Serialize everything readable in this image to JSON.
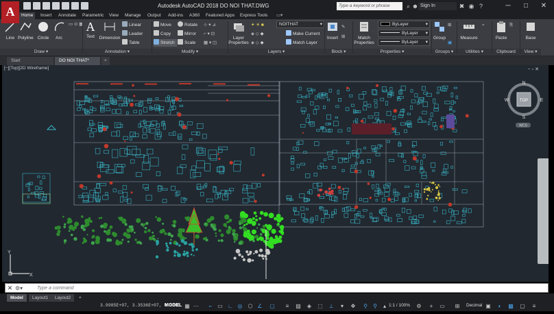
{
  "title_bar": {
    "logo_letter": "A",
    "window_title": "Autodesk AutoCAD 2018    DO NOI THAT.DWG",
    "search_placeholder": "Type a keyword or phrase",
    "signin_label": "Sign In"
  },
  "ribbon_tabs": [
    "Home",
    "Insert",
    "Annotate",
    "Parametric",
    "View",
    "Manage",
    "Output",
    "Add-ins",
    "A360",
    "Featured Apps",
    "Express Tools"
  ],
  "ribbon": {
    "draw": {
      "title": "Draw",
      "line": "Line",
      "polyline": "Polyline",
      "circle": "Circle",
      "arc": "Arc"
    },
    "annotation": {
      "title": "Annotation",
      "text": "Text",
      "dimension": "Dimension",
      "linear": "Linear",
      "leader": "Leader",
      "table": "Table"
    },
    "modify": {
      "title": "Modify",
      "move": "Move",
      "rotate": "Rotate",
      "copy": "Copy",
      "mirror": "Mirror",
      "stretch": "Stretch",
      "scale": "Scale"
    },
    "layers": {
      "title": "Layers",
      "layer_properties_1": "Layer",
      "layer_properties_2": "Properties",
      "current_layer": "NOITHAT",
      "make_current": "Make Current",
      "match_layer": "Match Layer"
    },
    "block": {
      "title": "Block",
      "insert": "Insert"
    },
    "properties": {
      "title": "Properties",
      "match_1": "Match",
      "match_2": "Properties",
      "color": "ByLayer",
      "linetype": "ByLayer",
      "lineweight": "ByLayer"
    },
    "groups": {
      "title": "Groups",
      "group": "Group"
    },
    "utilities": {
      "title": "Utilities",
      "measure": "Measure"
    },
    "clipboard": {
      "title": "Clipboard",
      "paste": "Paste"
    },
    "view": {
      "title": "View",
      "base": "Base"
    }
  },
  "file_tabs": {
    "start": "Start",
    "active_file": "DO NOI THAT*",
    "new_tab": "+"
  },
  "viewport": {
    "label": "[−][Top][2D Wireframe]",
    "controls": "−  ▫  ✕",
    "viewcube": {
      "n": "N",
      "s": "S",
      "e": "E",
      "w": "W",
      "top": "TOP",
      "wcs": "WCS"
    },
    "ucs": {
      "x": "X",
      "y": "Y"
    }
  },
  "command_line": {
    "close": "✕",
    "placeholder": "Type a command"
  },
  "layout_tabs": [
    "Model",
    "Layout1",
    "Layout2"
  ],
  "layout_add": "+",
  "status_bar": {
    "coordinates": "3.9985E+07, 3.3536E+07, 0.0000",
    "model": "MODEL",
    "annotation_scale": "1:1 / 100%",
    "units": "Decimal"
  },
  "colors": {
    "background": "#212830",
    "cyan": "#39b6c8",
    "red": "#c0392b",
    "green": "#2e8b2e",
    "bright_green": "#33dd22",
    "frame": "#9aa4ad",
    "accent_blue": "#4aa3e8"
  }
}
